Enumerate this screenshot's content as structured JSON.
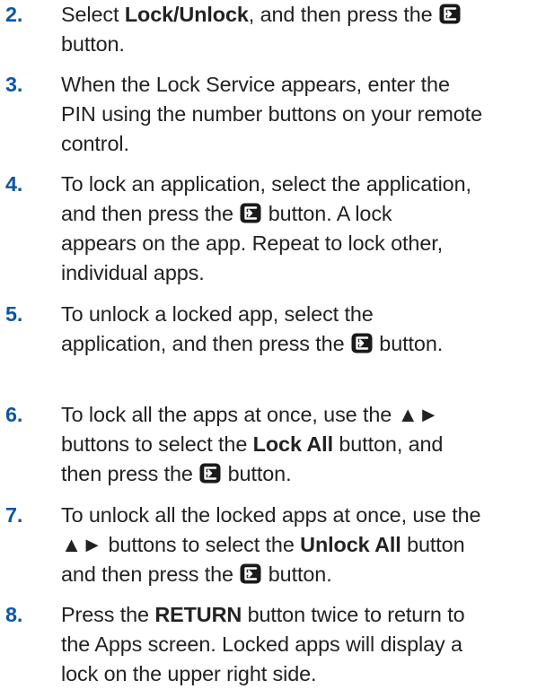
{
  "colors": {
    "step_number": "#0b57a4",
    "body_text": "#222222",
    "icon": "#1a1a1a"
  },
  "icons": {
    "enter": "enter-button-icon"
  },
  "steps": [
    {
      "number": "2.",
      "parts": [
        {
          "text": "Select "
        },
        {
          "text": "Lock/Unlock",
          "bold": true
        },
        {
          "text": ", and then press the "
        },
        {
          "icon": "enter"
        },
        {
          "text": "\nbutton."
        }
      ]
    },
    {
      "number": "3.",
      "parts": [
        {
          "text": "When the Lock Service appears, enter the\nPIN using the number buttons on your remote\ncontrol."
        }
      ]
    },
    {
      "number": "4.",
      "parts": [
        {
          "text": "To lock an application, select the application,\nand then press the "
        },
        {
          "icon": "enter"
        },
        {
          "text": " button. A lock\nappears on the app. Repeat to lock other,\nindividual apps."
        }
      ]
    },
    {
      "number": "5.",
      "parts": [
        {
          "text": "To unlock a locked app, select the\napplication, and then press the "
        },
        {
          "icon": "enter"
        },
        {
          "text": " button."
        }
      ]
    },
    {
      "number": "6.",
      "parts": [
        {
          "text": "To lock all the apps at once, use the ▲►\nbuttons to select the "
        },
        {
          "text": "Lock All",
          "bold": true
        },
        {
          "text": " button, and\nthen press the "
        },
        {
          "icon": "enter"
        },
        {
          "text": " button."
        }
      ]
    },
    {
      "number": "7.",
      "parts": [
        {
          "text": "To unlock all the locked apps at once, use the\n▲► buttons to select the "
        },
        {
          "text": "Unlock All",
          "bold": true
        },
        {
          "text": " button\nand then press the "
        },
        {
          "icon": "enter"
        },
        {
          "text": " button."
        }
      ]
    },
    {
      "number": "8.",
      "parts": [
        {
          "text": "Press the "
        },
        {
          "text": "RETURN",
          "bold": true
        },
        {
          "text": " button twice to return to\nthe Apps screen. Locked apps will display a\nlock on the upper right side."
        }
      ]
    }
  ]
}
